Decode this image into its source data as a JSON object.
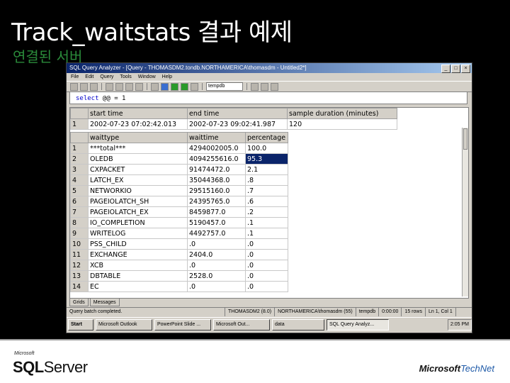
{
  "slide": {
    "title": "Track_waitstats 결과 예제",
    "subtitle": "연결된 서버"
  },
  "app": {
    "title": "SQL Query Analyzer - [Query - THOMASDM2.tondb.NORTHAMERICA\\thomasdm - Untitled2*]",
    "menus": [
      "File",
      "Edit",
      "Query",
      "Tools",
      "Window",
      "Help"
    ],
    "db_select": "tempdb"
  },
  "editor": {
    "keyword": "select",
    "rest": " @@ = 1"
  },
  "result1": {
    "columns": [
      "start time",
      "end time",
      "sample duration (minutes)"
    ],
    "rows": [
      {
        "n": "1",
        "cells": [
          "2002-07-23 07:02:42.013",
          "2002-07-23 09:02:41.987",
          "120"
        ]
      }
    ]
  },
  "result2": {
    "columns": [
      "waittype",
      "waittime",
      "percentage"
    ],
    "rows": [
      {
        "n": "1",
        "cells": [
          "***total***",
          "4294002005.0",
          "100.0"
        ]
      },
      {
        "n": "2",
        "cells": [
          "OLEDB",
          "4094255616.0",
          "95.3"
        ]
      },
      {
        "n": "3",
        "cells": [
          "CXPACKET",
          "91474472.0",
          "2.1"
        ]
      },
      {
        "n": "4",
        "cells": [
          "LATCH_EX",
          "35044368.0",
          ".8"
        ]
      },
      {
        "n": "5",
        "cells": [
          "NETWORKIO",
          "29515160.0",
          ".7"
        ]
      },
      {
        "n": "6",
        "cells": [
          "PAGEIOLATCH_SH",
          "24395765.0",
          ".6"
        ]
      },
      {
        "n": "7",
        "cells": [
          "PAGEIOLATCH_EX",
          "8459877.0",
          ".2"
        ]
      },
      {
        "n": "8",
        "cells": [
          "IO_COMPLETION",
          "5190457.0",
          ".1"
        ]
      },
      {
        "n": "9",
        "cells": [
          "WRITELOG",
          "4492757.0",
          ".1"
        ]
      },
      {
        "n": "10",
        "cells": [
          "PSS_CHILD",
          ".0",
          ".0"
        ]
      },
      {
        "n": "11",
        "cells": [
          "EXCHANGE",
          "2404.0",
          ".0"
        ]
      },
      {
        "n": "12",
        "cells": [
          "XCB",
          ".0",
          ".0"
        ]
      },
      {
        "n": "13",
        "cells": [
          "DBTABLE",
          "2528.0",
          ".0"
        ]
      },
      {
        "n": "14",
        "cells": [
          "EC",
          ".0",
          ".0"
        ]
      }
    ]
  },
  "tabs": [
    "Grids",
    "Messages"
  ],
  "status": {
    "left": "Query batch completed.",
    "server": "THOMASDM2 (8.0)",
    "user": "NORTHAMERICA\\thomasdm (55)",
    "db": "tempdb",
    "time": "0:00:00",
    "rows": "15 rows",
    "pos": "Ln 1, Col 1"
  },
  "taskbar": {
    "start": "Start",
    "items": [
      "Microsoft Outlook",
      "PowerPoint Slide ...",
      "Microsoft Out...",
      "data",
      "SQL Query Analyz..."
    ],
    "active_index": 4,
    "clock": "2:05 PM"
  },
  "brand": {
    "microsoft_small": "Microsoft",
    "sql_a": "SQL",
    "sql_b": "Server",
    "ms_logo": "Microsoft",
    "technet": "TechNet"
  },
  "selected_cell": "95.3"
}
